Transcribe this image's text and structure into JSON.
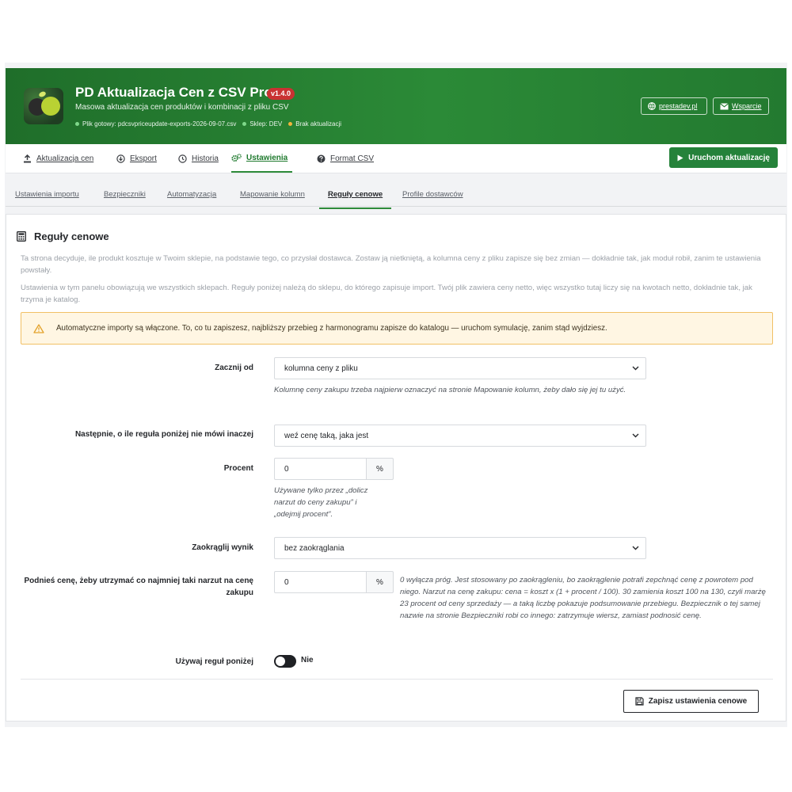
{
  "header": {
    "title": "PD Aktualizacja Cen z CSV Pro",
    "version": "v1.4.0",
    "subtitle": "Masowa aktualizacja cen produktów i kombinacji z pliku CSV",
    "status": [
      {
        "text": "Plik gotowy: pdcsvpriceupdate-exports-2026-09-07.csv",
        "color": "#7fd88a"
      },
      {
        "text": "Sklep: DEV",
        "color": "#7fd88a"
      },
      {
        "text": "Brak aktualizacji",
        "color": "#f2b43c"
      }
    ],
    "links": {
      "site": "prestadev.pl",
      "support": "Wsparcie"
    }
  },
  "main_tabs": [
    {
      "label": "Aktualizacja cen",
      "icon": "upload-icon"
    },
    {
      "label": "Eksport",
      "icon": "download-icon"
    },
    {
      "label": "Historia",
      "icon": "clock-icon"
    },
    {
      "label": "Ustawienia",
      "icon": "cogs-icon",
      "active": true
    },
    {
      "label": "Format CSV",
      "icon": "question-icon"
    }
  ],
  "run_button": "Uruchom aktualizację",
  "sub_tabs": [
    {
      "label": "Ustawienia importu"
    },
    {
      "label": "Bezpieczniki"
    },
    {
      "label": "Automatyzacja"
    },
    {
      "label": "Mapowanie kolumn"
    },
    {
      "label": "Reguły cenowe",
      "active": true
    },
    {
      "label": "Profile dostawców"
    }
  ],
  "panel": {
    "title": "Reguły cenowe",
    "desc1": "Ta strona decyduje, ile produkt kosztuje w Twoim sklepie, na podstawie tego, co przysłał dostawca. Zostaw ją nietkniętą, a kolumna ceny z pliku zapisze się bez zmian — dokładnie tak, jak moduł robił, zanim te ustawienia powstały.",
    "desc2": "Ustawienia w tym panelu obowiązują we wszystkich sklepach. Reguły poniżej należą do sklepu, do którego zapisuje import. Twój plik zawiera ceny netto, więc wszystko tutaj liczy się na kwotach netto, dokładnie tak, jak trzyma je katalog.",
    "warning": "Automatyczne importy są włączone. To, co tu zapiszesz, najbliższy przebieg z harmonogramu zapisze do katalogu — uruchom symulację, zanim stąd wyjdziesz."
  },
  "fields": {
    "start": {
      "label": "Zacznij od",
      "value": "kolumna ceny z pliku",
      "help": "Kolumnę ceny zakupu trzeba najpierw oznaczyć na stronie Mapowanie kolumn, żeby dało się jej tu użyć."
    },
    "then": {
      "label": "Następnie, o ile reguła poniżej nie mówi inaczej",
      "value": "weź cenę taką, jaka jest"
    },
    "percent": {
      "label": "Procent",
      "value": "0",
      "unit": "%",
      "help": "Używane tylko przez „dolicz narzut do ceny zakupu” i „odejmij procent”."
    },
    "round": {
      "label": "Zaokrąglij wynik",
      "value": "bez zaokrąglania"
    },
    "markup": {
      "label": "Podnieś cenę, żeby utrzymać co najmniej taki narzut na cenę zakupu",
      "value": "0",
      "unit": "%",
      "help": "0 wyłącza próg. Jest stosowany po zaokrągleniu, bo zaokrąglenie potrafi zepchnąć cenę z powrotem pod niego. Narzut na cenę zakupu: cena = koszt x (1 + procent / 100). 30 zamienia koszt 100 na 130, czyli marżę 23 procent od ceny sprzedaży — a taką liczbę pokazuje podsumowanie przebiegu. Bezpiecznik o tej samej nazwie na stronie Bezpieczniki robi co innego: zatrzymuje wiersz, zamiast podnosić cenę."
    },
    "use_rules": {
      "label": "Używaj reguł poniżej",
      "value": "Nie"
    }
  },
  "save_button": "Zapisz ustawienia cenowe"
}
